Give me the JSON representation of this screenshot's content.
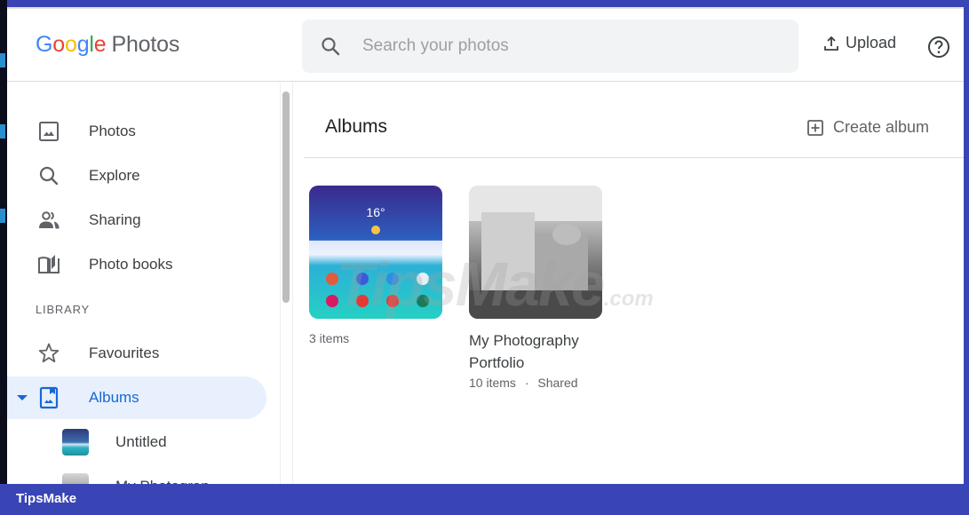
{
  "app": {
    "logo_letters": [
      "G",
      "o",
      "o",
      "g",
      "l",
      "e"
    ],
    "logo_product": "Photos"
  },
  "header": {
    "search_placeholder": "Search your photos",
    "search_value": "",
    "upload_label": "Upload",
    "help_icon": "help-circle-icon"
  },
  "sidebar": {
    "items": [
      {
        "label": "Photos",
        "icon": "photo-icon"
      },
      {
        "label": "Explore",
        "icon": "search-icon"
      },
      {
        "label": "Sharing",
        "icon": "people-icon"
      },
      {
        "label": "Photo books",
        "icon": "book-icon"
      }
    ],
    "section_label": "LIBRARY",
    "library_items": [
      {
        "label": "Favourites",
        "icon": "star-icon",
        "active": false
      },
      {
        "label": "Albums",
        "icon": "album-icon",
        "active": true,
        "expanded": true
      }
    ],
    "album_subitems": [
      {
        "label": "Untitled"
      },
      {
        "label": "My Photograp"
      }
    ]
  },
  "main": {
    "title": "Albums",
    "create_label": "Create album",
    "albums": [
      {
        "title": "",
        "meta": "3 items"
      },
      {
        "title": "My Photography Portfolio",
        "title_line1": "My Photography",
        "title_line2": "Portfolio",
        "items": "10 items",
        "separator": "·",
        "shared": "Shared"
      }
    ]
  },
  "watermark": {
    "text": "TipsMake",
    "suffix": ".com"
  },
  "footer": {
    "brand": "TipsMake"
  },
  "colors": {
    "accent": "#1967d2",
    "active_bg": "#e8f0fe",
    "frame": "#3a45b5",
    "text": "#3c4043",
    "muted": "#5f6368"
  }
}
